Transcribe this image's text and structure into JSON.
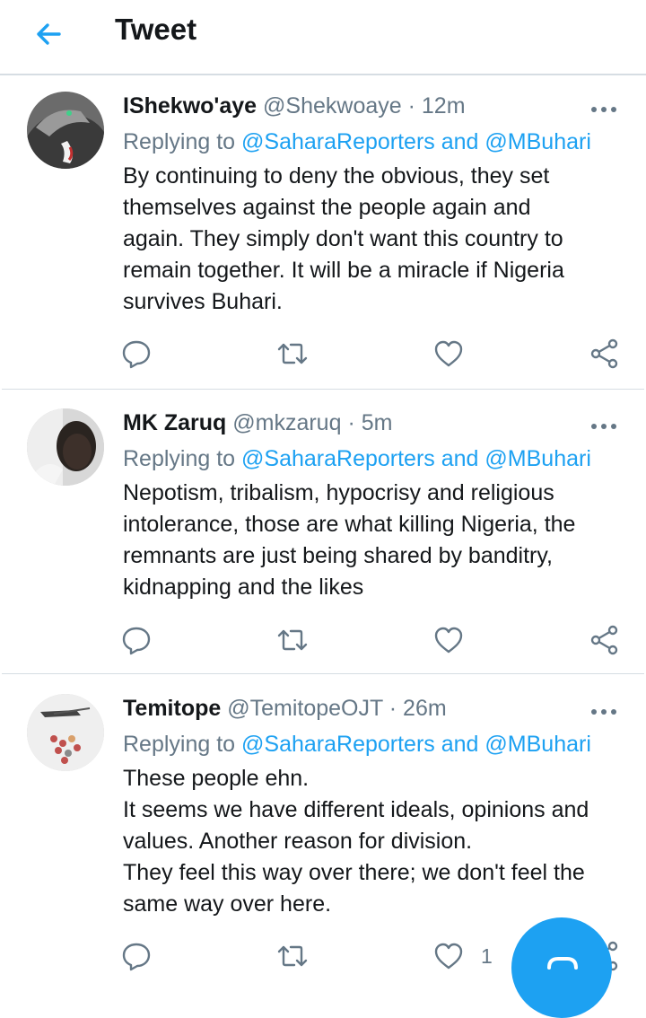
{
  "header": {
    "title": "Tweet"
  },
  "tweets": [
    {
      "name": "IShekwo'aye",
      "handle": "@Shekwoaye",
      "sep": "·",
      "time": "12m",
      "replying_prefix": "Replying to",
      "mention_1": "@SaharaReporters",
      "and": "and",
      "mention_2": "@MBuhari",
      "text": "By continuing to deny the obvious, they set\nthemselves against the people again and\nagain. They simply don't want this country to\nremain together. It will be a miracle if Nigeria\nsurvives Buhari.",
      "like_count": ""
    },
    {
      "name": "MK Zaruq",
      "handle": "@mkzaruq",
      "sep": "·",
      "time": "5m",
      "replying_prefix": "Replying to",
      "mention_1": "@SaharaReporters",
      "and": "and",
      "mention_2": "@MBuhari",
      "text": "Nepotism, tribalism, hypocrisy and religious\nintolerance, those are what killing Nigeria, the\nremnants are just being shared by banditry,\nkidnapping and the likes",
      "like_count": ""
    },
    {
      "name": "Temitope",
      "handle": "@TemitopeOJT",
      "sep": "·",
      "time": "26m",
      "replying_prefix": "Replying to",
      "mention_1": "@SaharaReporters",
      "and": "and",
      "mention_2": "@MBuhari",
      "text": "These people ehn.\nIt seems we have different ideals, opinions and\nvalues. Another reason for division.\nThey feel this way over there; we don't feel the\nsame way over here.",
      "like_count": "1"
    }
  ],
  "icons": {
    "back": "back-arrow-icon",
    "more": "more-dots-icon",
    "reply": "reply-icon",
    "retweet": "retweet-icon",
    "like": "heart-icon",
    "share": "share-icon",
    "compose": "compose-icon"
  },
  "colors": {
    "accent": "#1da1f2",
    "muted": "#657786",
    "text": "#14171a",
    "divider": "#d6dde3"
  }
}
